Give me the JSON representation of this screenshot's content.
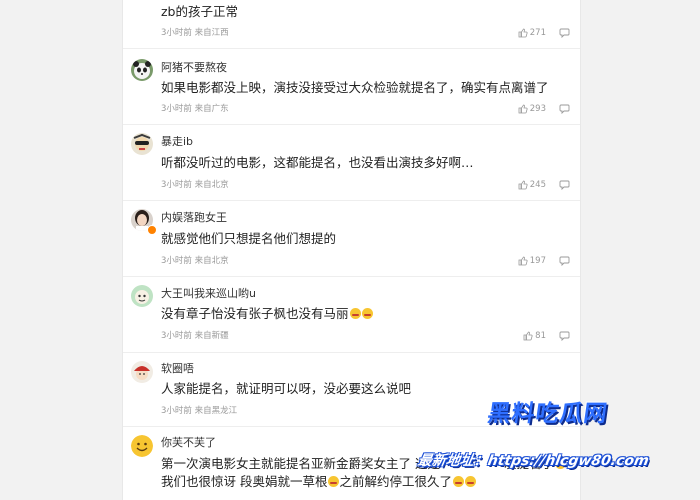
{
  "comments": [
    {
      "username": "",
      "text": "zb的孩子正常",
      "time": "3小时前",
      "location": "来自江西",
      "likes": "271",
      "avatar": "none"
    },
    {
      "username": "阿猪不要熬夜",
      "text": "如果电影都没上映，演技没接受过大众检验就提名了，确实有点离谱了",
      "time": "3小时前",
      "location": "来自广东",
      "likes": "293",
      "avatar": "panda-avatar"
    },
    {
      "username": "暴走ib",
      "text": "听都没听过的电影，这都能提名，也没看出演技多好啊…",
      "time": "3小时前",
      "location": "来自北京",
      "likes": "245",
      "avatar": "cartoon-avatar"
    },
    {
      "username": "内娱落跑女王",
      "text": "就感觉他们只想提名他们想提的",
      "time": "3小时前",
      "location": "来自北京",
      "likes": "197",
      "avatar": "woman-avatar"
    },
    {
      "username": "大王叫我来巡山哟u",
      "text": "没有章子怡没有张子枫也没有马丽",
      "time": "3小时前",
      "location": "来自新疆",
      "likes": "81",
      "avatar": "green-cartoon-avatar"
    },
    {
      "username": "软圈唔",
      "text": "人家能提名，就证明可以呀，没必要这么说吧",
      "time": "3小时前",
      "location": "来自黑龙江",
      "likes": "",
      "avatar": "red-cap-avatar"
    },
    {
      "username": "你芙不芙了",
      "text_line1": "第一次演电影女主就能提名亚新金爵奖女主了 这是",
      "text_line1_tail": "次提名了",
      "text_line2_a": "我们也很惊讶 段奥娟就一草根",
      "text_line2_b": "之前解约停工很久了",
      "time": "",
      "location": "",
      "likes": "",
      "avatar": "smiley-avatar"
    }
  ],
  "watermark": {
    "line1": "黑料吃瓜网",
    "line2": "最新地址：https://hlcgw80.com"
  },
  "colors": {
    "badge": "#ff8200",
    "watermark": "#2f6fff"
  }
}
